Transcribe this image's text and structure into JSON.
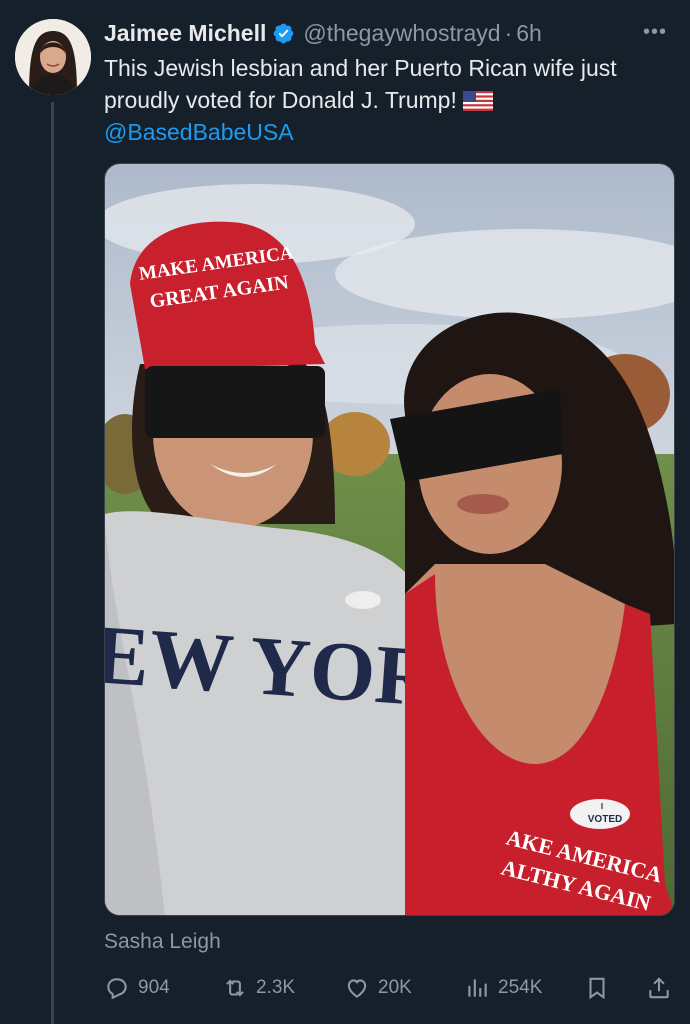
{
  "tweet": {
    "author_name": "Jaimee Michell",
    "handle": "@thegaywhostrayd",
    "separator": "·",
    "time": "6h",
    "more_label": "•••",
    "text_line": "This Jewish lesbian and her Puerto Rican wife just proudly voted for Donald J. Trump!",
    "flag_icon": "us-flag-emoji",
    "mention": "@BasedBabeUSA",
    "photo_credit": "Sasha Leigh",
    "media": {
      "hat_text_line1": "MAKE AMERICA",
      "hat_text_line2": "GREAT AGAIN",
      "sweatshirt_text": "NEW YORK",
      "sticker_text": "VOTED",
      "sticker_text_small": "I",
      "tank_text_line1": "AKE AMERICA",
      "tank_text_line2": "ALTHY AGAIN"
    }
  },
  "actions": {
    "replies": "904",
    "reposts": "2.3K",
    "likes": "20K",
    "views": "254K"
  },
  "colors": {
    "background": "#15202b",
    "text": "#e7e9ea",
    "muted": "#8b98a5",
    "link": "#1d9bf0",
    "verified": "#1d9bf0"
  }
}
